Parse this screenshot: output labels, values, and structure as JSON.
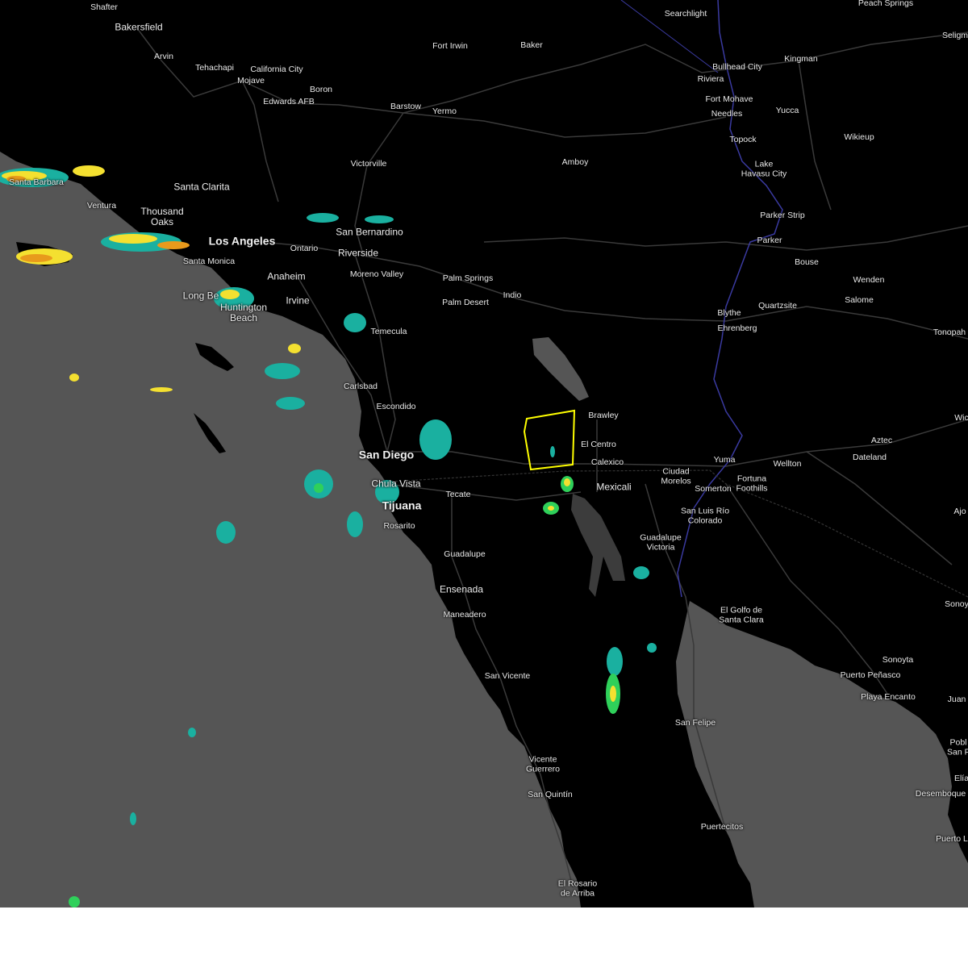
{
  "colors": {
    "land": "#000000",
    "water": "#555555",
    "roads": "#3a3a3a",
    "border": "#3a3aa0",
    "warning_polygon": "#ffff00",
    "radar_light": "#1ab0a0",
    "radar_medium": "#2fd05a",
    "radar_heavy": "#f4e030",
    "radar_intense": "#e89a1c"
  },
  "cities": [
    {
      "id": "shafter",
      "name": "Shafter",
      "class": "small"
    },
    {
      "id": "bakersfield",
      "name": "Bakersfield",
      "class": "mid"
    },
    {
      "id": "arvin",
      "name": "Arvin",
      "class": "small"
    },
    {
      "id": "tehachapi",
      "name": "Tehachapi",
      "class": "small"
    },
    {
      "id": "california-city",
      "name": "California City",
      "class": "small"
    },
    {
      "id": "mojave",
      "name": "Mojave",
      "class": "small"
    },
    {
      "id": "boron",
      "name": "Boron",
      "class": "small"
    },
    {
      "id": "edwards-afb",
      "name": "Edwards AFB",
      "class": "small"
    },
    {
      "id": "fort-irwin",
      "name": "Fort Irwin",
      "class": "small"
    },
    {
      "id": "baker",
      "name": "Baker",
      "class": "small"
    },
    {
      "id": "searchlight",
      "name": "Searchlight",
      "class": "small"
    },
    {
      "id": "peach-springs",
      "name": "Peach Springs",
      "class": "small"
    },
    {
      "id": "seligman",
      "name": "Seligm",
      "class": "small"
    },
    {
      "id": "bullhead-city",
      "name": "Bullhead City",
      "class": "small"
    },
    {
      "id": "kingman",
      "name": "Kingman",
      "class": "small"
    },
    {
      "id": "riviera",
      "name": "Riviera",
      "class": "small"
    },
    {
      "id": "fort-mohave",
      "name": "Fort Mohave",
      "class": "small"
    },
    {
      "id": "needles",
      "name": "Needles",
      "class": "small"
    },
    {
      "id": "yucca",
      "name": "Yucca",
      "class": "small"
    },
    {
      "id": "barstow",
      "name": "Barstow",
      "class": "small"
    },
    {
      "id": "yermo",
      "name": "Yermo",
      "class": "small"
    },
    {
      "id": "topock",
      "name": "Topock",
      "class": "small"
    },
    {
      "id": "wikieup",
      "name": "Wikieup",
      "class": "small"
    },
    {
      "id": "victorville",
      "name": "Victorville",
      "class": "small"
    },
    {
      "id": "amboy",
      "name": "Amboy",
      "class": "small"
    },
    {
      "id": "lake-havasu-city",
      "name": "Lake\nHavasu City",
      "class": "small"
    },
    {
      "id": "santa-clarita",
      "name": "Santa Clarita",
      "class": "mid"
    },
    {
      "id": "santa-barbara",
      "name": "Santa Barbara",
      "class": "small"
    },
    {
      "id": "ventura",
      "name": "Ventura",
      "class": "small"
    },
    {
      "id": "thousand-oaks",
      "name": "Thousand\nOaks",
      "class": "mid"
    },
    {
      "id": "los-angeles",
      "name": "Los Angeles",
      "class": "major"
    },
    {
      "id": "san-bernardino",
      "name": "San Bernardino",
      "class": "mid"
    },
    {
      "id": "parker-strip",
      "name": "Parker Strip",
      "class": "small"
    },
    {
      "id": "parker",
      "name": "Parker",
      "class": "small"
    },
    {
      "id": "ontario",
      "name": "Ontario",
      "class": "small"
    },
    {
      "id": "riverside",
      "name": "Riverside",
      "class": "mid"
    },
    {
      "id": "santa-monica",
      "name": "Santa Monica",
      "class": "small"
    },
    {
      "id": "bouse",
      "name": "Bouse",
      "class": "small"
    },
    {
      "id": "anaheim",
      "name": "Anaheim",
      "class": "mid"
    },
    {
      "id": "moreno-valley",
      "name": "Moreno Valley",
      "class": "small"
    },
    {
      "id": "palm-springs",
      "name": "Palm Springs",
      "class": "small"
    },
    {
      "id": "wenden",
      "name": "Wenden",
      "class": "small"
    },
    {
      "id": "long-beach",
      "name": "Long Be",
      "class": "mid"
    },
    {
      "id": "indio",
      "name": "Indio",
      "class": "small"
    },
    {
      "id": "irvine",
      "name": "Irvine",
      "class": "mid"
    },
    {
      "id": "palm-desert",
      "name": "Palm Desert",
      "class": "small"
    },
    {
      "id": "salome",
      "name": "Salome",
      "class": "small"
    },
    {
      "id": "huntington-beach",
      "name": "Huntington\nBeach",
      "class": "mid"
    },
    {
      "id": "quartzsite",
      "name": "Quartzsite",
      "class": "small"
    },
    {
      "id": "blythe",
      "name": "Blythe",
      "class": "small"
    },
    {
      "id": "ehrenberg",
      "name": "Ehrenberg",
      "class": "small"
    },
    {
      "id": "tonopah",
      "name": "Tonopah",
      "class": "small"
    },
    {
      "id": "temecula",
      "name": "Temecula",
      "class": "small"
    },
    {
      "id": "carlsbad",
      "name": "Carlsbad",
      "class": "small"
    },
    {
      "id": "escondido",
      "name": "Escondido",
      "class": "small"
    },
    {
      "id": "brawley",
      "name": "Brawley",
      "class": "small"
    },
    {
      "id": "wickenburg",
      "name": "Wic",
      "class": "small"
    },
    {
      "id": "el-centro",
      "name": "El Centro",
      "class": "small"
    },
    {
      "id": "aztec",
      "name": "Aztec",
      "class": "small"
    },
    {
      "id": "san-diego",
      "name": "San Diego",
      "class": "major"
    },
    {
      "id": "dateland",
      "name": "Dateland",
      "class": "small"
    },
    {
      "id": "calexico",
      "name": "Calexico",
      "class": "small"
    },
    {
      "id": "yuma",
      "name": "Yuma",
      "class": "small"
    },
    {
      "id": "wellton",
      "name": "Wellton",
      "class": "small"
    },
    {
      "id": "ciudad-morelos",
      "name": "Ciudad\nMorelos",
      "class": "small"
    },
    {
      "id": "fortuna-foothills",
      "name": "Fortuna\nFoothills",
      "class": "small"
    },
    {
      "id": "chula-vista",
      "name": "Chula Vista",
      "class": "mid"
    },
    {
      "id": "mexicali",
      "name": "Mexicali",
      "class": "mid"
    },
    {
      "id": "somerton",
      "name": "Somerton",
      "class": "small"
    },
    {
      "id": "tecate",
      "name": "Tecate",
      "class": "small"
    },
    {
      "id": "tijuana",
      "name": "Tijuana",
      "class": "major"
    },
    {
      "id": "san-luis-rio-colorado",
      "name": "San Luis Río\nColorado",
      "class": "small"
    },
    {
      "id": "ajo",
      "name": "Ajo",
      "class": "small"
    },
    {
      "id": "rosarito",
      "name": "Rosarito",
      "class": "small"
    },
    {
      "id": "guadalupe-victoria",
      "name": "Guadalupe\nVictoria",
      "class": "small"
    },
    {
      "id": "guadalupe",
      "name": "Guadalupe",
      "class": "small"
    },
    {
      "id": "ensenada",
      "name": "Ensenada",
      "class": "mid"
    },
    {
      "id": "sonoyta-top",
      "name": "Sonoy",
      "class": "small"
    },
    {
      "id": "el-golfo",
      "name": "El Golfo de\nSanta Clara",
      "class": "small"
    },
    {
      "id": "maneadero",
      "name": "Maneadero",
      "class": "small"
    },
    {
      "id": "sonoyta",
      "name": "Sonoyta",
      "class": "small"
    },
    {
      "id": "san-vicente",
      "name": "San Vicente",
      "class": "small"
    },
    {
      "id": "puerto-penasco",
      "name": "Puerto Peñasco",
      "class": "small"
    },
    {
      "id": "playa-encanto",
      "name": "Playa Encanto",
      "class": "small"
    },
    {
      "id": "juan",
      "name": "Juan",
      "class": "small"
    },
    {
      "id": "san-felipe",
      "name": "San Felipe",
      "class": "small"
    },
    {
      "id": "poblado",
      "name": "Pobl\nSan F",
      "class": "small"
    },
    {
      "id": "vicente-guerrero",
      "name": "Vicente\nGuerrero",
      "class": "small"
    },
    {
      "id": "elias",
      "name": "Elía",
      "class": "small"
    },
    {
      "id": "san-quintin",
      "name": "San Quintín",
      "class": "small"
    },
    {
      "id": "desemboque",
      "name": "Desemboque",
      "class": "small"
    },
    {
      "id": "puertecitos",
      "name": "Puertecitos",
      "class": "small"
    },
    {
      "id": "puerto-libertad",
      "name": "Puerto L",
      "class": "small"
    },
    {
      "id": "el-rosario",
      "name": "El Rosario\nde Arriba",
      "class": "small"
    }
  ]
}
